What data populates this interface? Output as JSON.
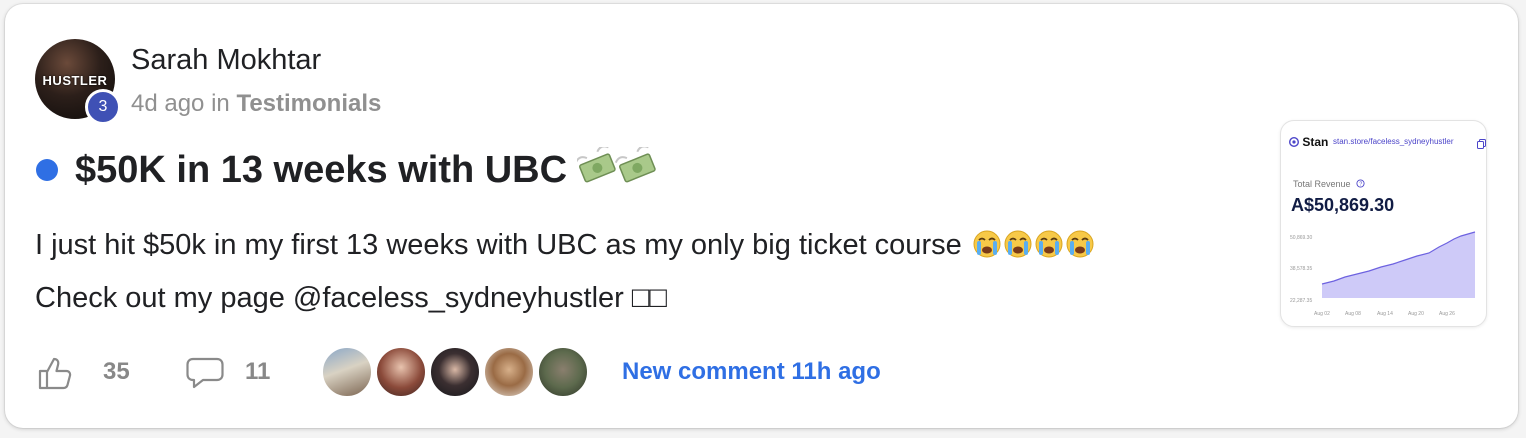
{
  "post": {
    "author": "Sarah Mokhtar",
    "avatar_text": "HUSTLER",
    "level": "3",
    "time_ago": "4d ago",
    "in_word": "in",
    "category": "Testimonials",
    "title": "$50K in 13 weeks with UBC",
    "title_emoji": "money-with-wings-icon",
    "body_line1": "I just hit $50k in my first 13 weeks with UBC as my only big ticket course",
    "body_line1_emoji": "loudly-crying-face-icon",
    "body_line2": "Check out my page @faceless_sydneyhustler □□"
  },
  "thumbnail": {
    "brand": "Stan",
    "url": "stan.store/faceless_sydneyhustler",
    "label": "Total Revenue",
    "value": "A$50,869.30",
    "y_ticks": [
      "50,869.30",
      "38,578.35",
      "22,287.35"
    ],
    "x_ticks": [
      "Aug 02",
      "Aug 08",
      "Aug 14",
      "Aug 20",
      "Aug 26"
    ]
  },
  "footer": {
    "likes": "35",
    "comments": "11",
    "new_comment": "New comment 11h ago"
  },
  "colors": {
    "accent": "#2f6fe4",
    "level_badge": "#3f51b5",
    "muted": "#909090",
    "chart_fill": "#b8b2f5"
  }
}
